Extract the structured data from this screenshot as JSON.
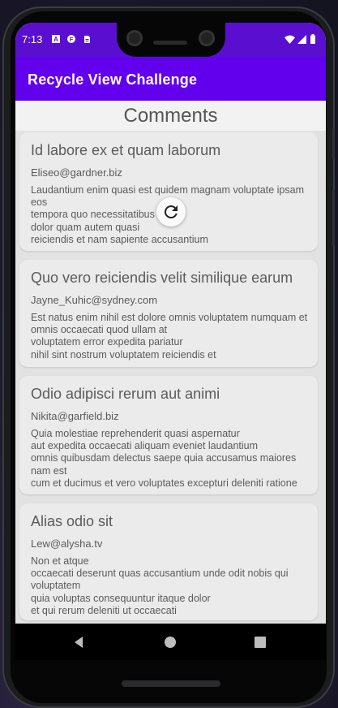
{
  "status_bar": {
    "time": "7:13",
    "left_icons": [
      "a-notification-icon",
      "f-notification-icon",
      "clipboard-icon"
    ],
    "right_icons": [
      "wifi-icon",
      "signal-icon",
      "battery-icon"
    ],
    "color": "#5a0fd0"
  },
  "app_bar": {
    "title": "Recycle View Challenge",
    "color": "#6200ee"
  },
  "page": {
    "title": "Comments"
  },
  "comments": [
    {
      "title": "Id labore ex et quam laborum",
      "email": "Eliseo@gardner.biz",
      "body": "Laudantium enim quasi est quidem magnam voluptate ipsam eos\ntempora quo necessitatibus\ndolor quam autem quasi\nreiciendis et nam sapiente accusantium"
    },
    {
      "title": "Quo vero reiciendis velit similique earum",
      "email": "Jayne_Kuhic@sydney.com",
      "body": "Est natus enim nihil est dolore omnis voluptatem numquam et omnis occaecati quod ullam at\nvoluptatem error expedita pariatur\nnihil sint nostrum voluptatem reiciendis et"
    },
    {
      "title": "Odio adipisci rerum aut animi",
      "email": "Nikita@garfield.biz",
      "body": "Quia molestiae reprehenderit quasi aspernatur\naut expedita occaecati aliquam eveniet laudantium\nomnis quibusdam delectus saepe quia accusamus maiores nam est\ncum et ducimus et vero voluptates excepturi deleniti ratione"
    },
    {
      "title": "Alias odio sit",
      "email": "Lew@alysha.tv",
      "body": "Non et atque\noccaecati deserunt quas accusantium unde odit nobis qui voluptatem\nquia voluptas consequuntur itaque dolor\net qui rerum deleniti ut occaecati"
    }
  ],
  "refresh_indicator": {
    "icon": "refresh-icon"
  },
  "navigation": {
    "buttons": [
      "back-icon",
      "home-icon",
      "recents-icon"
    ]
  }
}
